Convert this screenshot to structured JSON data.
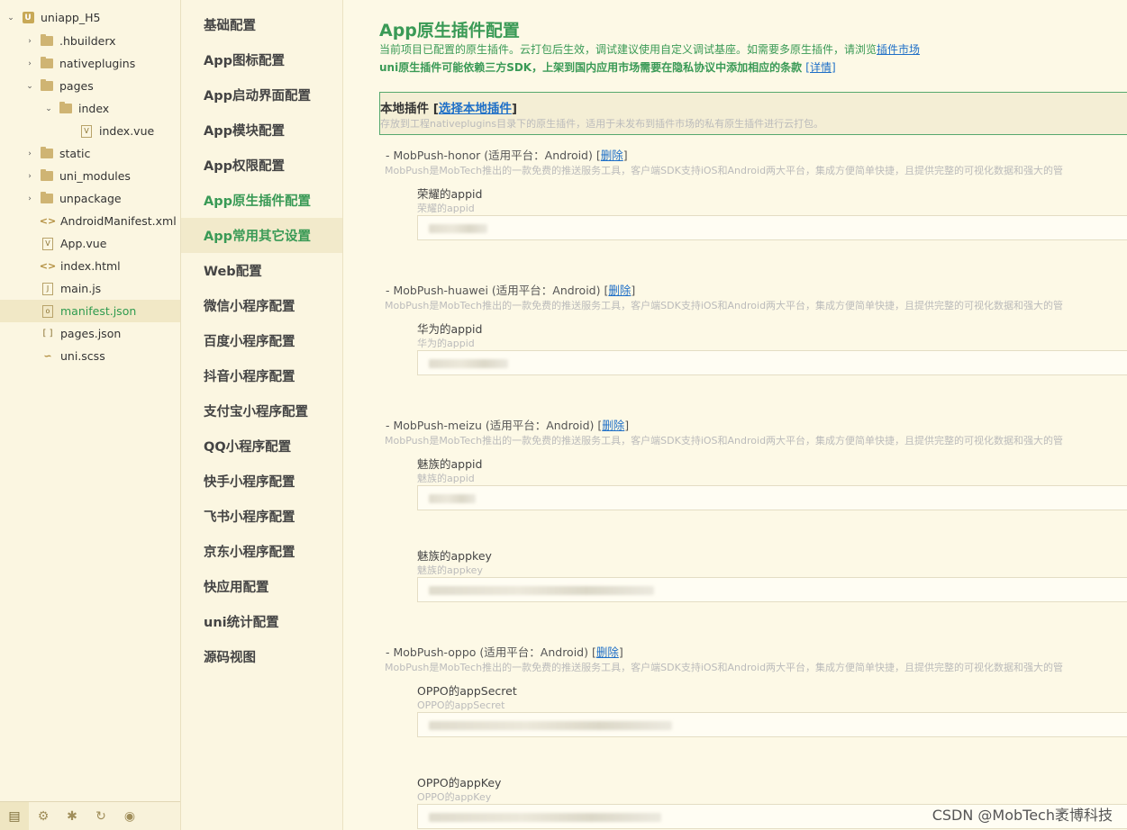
{
  "file_tree": {
    "items": [
      {
        "label": "uniapp_H5",
        "kind": "project",
        "expanded": true
      },
      {
        "label": ".hbuilderx",
        "kind": "folder"
      },
      {
        "label": "nativeplugins",
        "kind": "folder"
      },
      {
        "label": "pages",
        "kind": "folder",
        "expanded": true
      },
      {
        "label": "index",
        "kind": "folder",
        "expanded": true
      },
      {
        "label": "index.vue",
        "kind": "vue"
      },
      {
        "label": "static",
        "kind": "folder"
      },
      {
        "label": "uni_modules",
        "kind": "folder"
      },
      {
        "label": "unpackage",
        "kind": "folder"
      },
      {
        "label": "AndroidManifest.xml",
        "kind": "xml"
      },
      {
        "label": "App.vue",
        "kind": "vue"
      },
      {
        "label": "index.html",
        "kind": "html"
      },
      {
        "label": "main.js",
        "kind": "js"
      },
      {
        "label": "manifest.json",
        "kind": "json",
        "selected": true
      },
      {
        "label": "pages.json",
        "kind": "json"
      },
      {
        "label": "uni.scss",
        "kind": "scss"
      }
    ],
    "footer_icons": [
      "files-icon",
      "plugin-icon",
      "bug-icon",
      "refresh-icon",
      "browser-icon"
    ]
  },
  "nav": {
    "items": [
      "基础配置",
      "App图标配置",
      "App启动界面配置",
      "App模块配置",
      "App权限配置",
      "App原生插件配置",
      "App常用其它设置",
      "Web配置",
      "微信小程序配置",
      "百度小程序配置",
      "抖音小程序配置",
      "支付宝小程序配置",
      "QQ小程序配置",
      "快手小程序配置",
      "飞书小程序配置",
      "京东小程序配置",
      "快应用配置",
      "uni统计配置",
      "源码视图"
    ],
    "current_index": 5,
    "hover_index": 6
  },
  "main": {
    "title": "App原生插件配置",
    "line1_text": "当前项目已配置的原生插件。云打包后生效，调试建议使用自定义调试基座。如需要多原生插件，请浏览",
    "line1_link": "插件市场",
    "line2_text": "uni原生插件可能依赖三方SDK，上架到国内应用市场需要在隐私协议中添加相应的条款",
    "line2_link": "[详情]",
    "local": {
      "title": "本地插件",
      "bracket_open": "[",
      "link": "选择本地插件",
      "bracket_close": "]",
      "desc": "存放到工程nativeplugins目录下的原生插件，适用于未发布到插件市场的私有原生插件进行云打包。"
    },
    "plugins": [
      {
        "head": "- MobPush-honor (适用平台：Android) ",
        "delete": "删除",
        "desc": "MobPush是MobTech推出的一款免费的推送服务工具，客户端SDK支持iOS和Android两大平台，集成方便简单快捷，且提供完整的可视化数据和强大的管",
        "fields": [
          {
            "label": "荣耀的appid",
            "hint": "荣耀的appid"
          }
        ]
      },
      {
        "head": "- MobPush-huawei (适用平台：Android) ",
        "delete": "删除",
        "desc": "MobPush是MobTech推出的一款免费的推送服务工具，客户端SDK支持iOS和Android两大平台，集成方便简单快捷，且提供完整的可视化数据和强大的管",
        "fields": [
          {
            "label": "华为的appid",
            "hint": "华为的appid"
          }
        ]
      },
      {
        "head": "- MobPush-meizu (适用平台：Android) ",
        "delete": "删除",
        "desc": "MobPush是MobTech推出的一款免费的推送服务工具，客户端SDK支持iOS和Android两大平台，集成方便简单快捷，且提供完整的可视化数据和强大的管",
        "fields": [
          {
            "label": "魅族的appid",
            "hint": "魅族的appid"
          },
          {
            "label": "魅族的appkey",
            "hint": "魅族的appkey"
          }
        ]
      },
      {
        "head": "- MobPush-oppo (适用平台：Android) ",
        "delete": "删除",
        "desc": "MobPush是MobTech推出的一款免费的推送服务工具，客户端SDK支持iOS和Android两大平台，集成方便简单快捷，且提供完整的可视化数据和强大的管",
        "fields": [
          {
            "label": "OPPO的appSecret",
            "hint": "OPPO的appSecret"
          },
          {
            "label": "OPPO的appKey",
            "hint": "OPPO的appKey"
          }
        ]
      }
    ]
  },
  "watermark": "CSDN @MobTech袤博科技",
  "colors": {
    "accent": "#3a9a56",
    "link": "#1e6fc7",
    "background": "#fdf8e4"
  }
}
